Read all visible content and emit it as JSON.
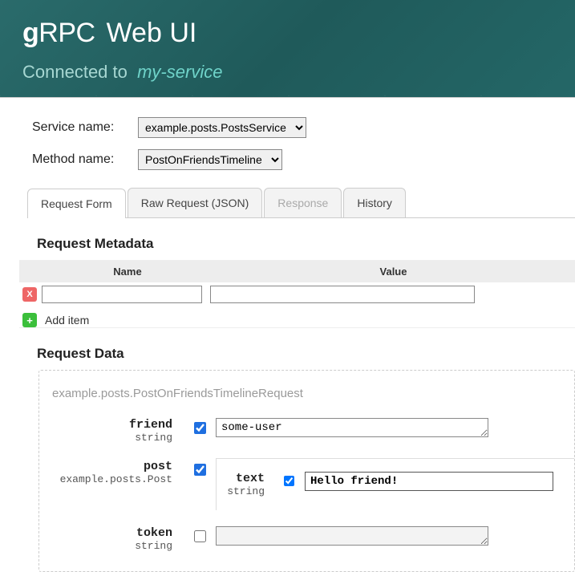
{
  "header": {
    "logo_prefix": "g",
    "logo_suffix": "RPC",
    "app_title": "Web UI",
    "connected_label": "Connected to",
    "service_name": "my-service"
  },
  "selectors": {
    "service_label": "Service name:",
    "service_value": "example.posts.PostsService",
    "method_label": "Method name:",
    "method_value": "PostOnFriendsTimeline"
  },
  "tabs": {
    "request_form": "Request Form",
    "raw_request": "Raw Request (JSON)",
    "response": "Response",
    "history": "History"
  },
  "metadata": {
    "title": "Request Metadata",
    "col_name": "Name",
    "col_value": "Value",
    "delete_symbol": "X",
    "add_symbol": "+",
    "add_label": "Add item",
    "rows": [
      {
        "name": "",
        "value": ""
      }
    ]
  },
  "request_data": {
    "title": "Request Data",
    "type_name": "example.posts.PostOnFriendsTimelineRequest",
    "fields": {
      "friend": {
        "name": "friend",
        "type": "string",
        "enabled": true,
        "value": "some-user"
      },
      "post": {
        "name": "post",
        "type": "example.posts.Post",
        "enabled": true,
        "nested": {
          "text": {
            "name": "text",
            "type": "string",
            "enabled": true,
            "value": "Hello friend!"
          }
        }
      },
      "token": {
        "name": "token",
        "type": "string",
        "enabled": false,
        "value": ""
      }
    }
  }
}
